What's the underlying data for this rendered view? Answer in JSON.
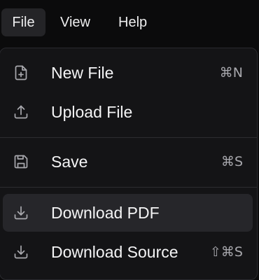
{
  "menubar": {
    "items": [
      {
        "label": "File",
        "active": true
      },
      {
        "label": "View",
        "active": false
      },
      {
        "label": "Help",
        "active": false
      }
    ]
  },
  "file_menu": {
    "items": [
      {
        "label": "New File",
        "shortcut": "⌘N",
        "icon": "file-plus-icon"
      },
      {
        "label": "Upload File",
        "shortcut": "",
        "icon": "upload-icon"
      },
      {
        "label": "Save",
        "shortcut": "⌘S",
        "icon": "save-icon"
      },
      {
        "label": "Download PDF",
        "shortcut": "",
        "icon": "download-icon",
        "highlighted": true
      },
      {
        "label": "Download Source",
        "shortcut": "⇧⌘S",
        "icon": "download-icon"
      }
    ]
  },
  "colors": {
    "background": "#0b0b0c",
    "menu_surface": "#141416",
    "active_menubar": "#242427",
    "hover_item": "#26262a",
    "text": "#f4f4f5",
    "shortcut_text": "#a8a8ad",
    "divider": "#2c2c30"
  }
}
